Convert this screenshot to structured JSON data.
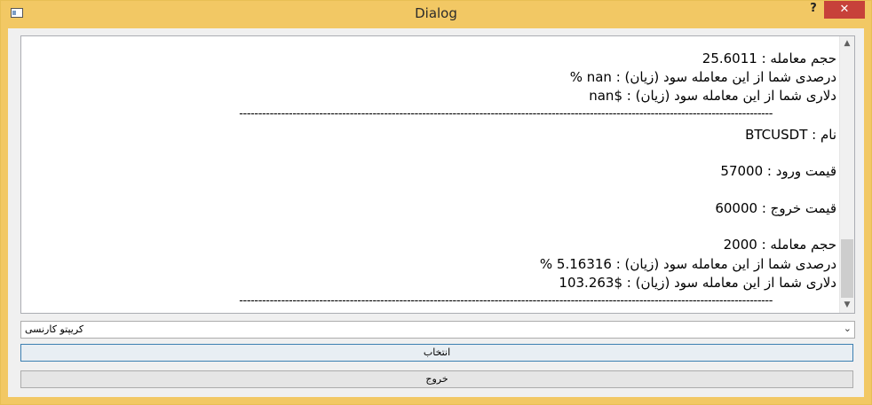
{
  "window": {
    "title": "Dialog",
    "help_glyph": "?",
    "close_glyph": "✕"
  },
  "results": {
    "lines_top": [
      "حجم معامله : 25.6011",
      "درصدی شما از این معامله سود (زیان) : nan %",
      "دلاری شما از این معامله سود (زیان) : $nan"
    ],
    "separator": "--------------------------------------------------------------------------------------------------------------------------------------------",
    "name_line": "نام : BTCUSDT",
    "entry_line": "قیمت ورود : 57000",
    "exit_line": "قیمت خروج : 60000",
    "volume_line": "حجم معامله : 2000",
    "percent_line": "درصدی شما از این معامله سود (زیان) : 5.16316 %",
    "dollar_line": "دلاری شما از این معامله سود (زیان) : $103.263"
  },
  "combo": {
    "selected": "کریپتو کارنسی"
  },
  "buttons": {
    "select": "انتخاب",
    "exit": "خروج"
  }
}
